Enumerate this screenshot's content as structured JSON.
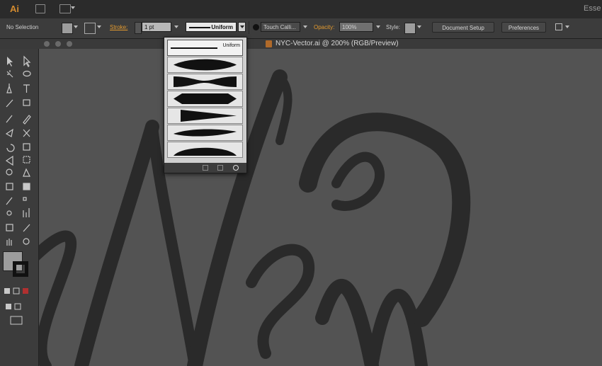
{
  "app": {
    "logo": "Ai",
    "workspace_label": "Esse"
  },
  "control_bar": {
    "selection_label": "No Selection",
    "stroke_label": "Stroke:",
    "stroke_weight": "1 pt",
    "stroke_profile": "Uniform",
    "brush_label": "Touch Calli...",
    "opacity_label": "Opacity:",
    "opacity_value": "100%",
    "style_label": "Style:",
    "document_setup_label": "Document Setup",
    "preferences_label": "Preferences"
  },
  "document": {
    "tab_title": "NYC-Vector.ai @ 200% (RGB/Preview)"
  },
  "profile_popup": {
    "items": [
      {
        "name": "uniform",
        "label": "Uniform"
      },
      {
        "name": "width-profile-1"
      },
      {
        "name": "width-profile-2"
      },
      {
        "name": "width-profile-3"
      },
      {
        "name": "width-profile-4"
      },
      {
        "name": "width-profile-5"
      },
      {
        "name": "width-profile-6"
      }
    ]
  },
  "colors": {
    "accent": "#e39a2f",
    "canvas": "#535353",
    "artwork": "#2a2a2a",
    "panel": "#3c3c3c"
  },
  "tools": [
    "selection-tool",
    "direct-selection-tool",
    "magic-wand-tool",
    "lasso-tool",
    "pen-tool",
    "type-tool",
    "line-tool",
    "rectangle-tool",
    "paintbrush-tool",
    "pencil-tool",
    "blob-brush-tool",
    "eraser-tool",
    "rotate-tool",
    "scale-tool",
    "width-tool",
    "free-transform-tool",
    "shape-builder-tool",
    "perspective-grid-tool",
    "mesh-tool",
    "gradient-tool",
    "eyedropper-tool",
    "blend-tool",
    "symbol-sprayer-tool",
    "column-graph-tool",
    "artboard-tool",
    "slice-tool",
    "hand-tool",
    "zoom-tool"
  ]
}
